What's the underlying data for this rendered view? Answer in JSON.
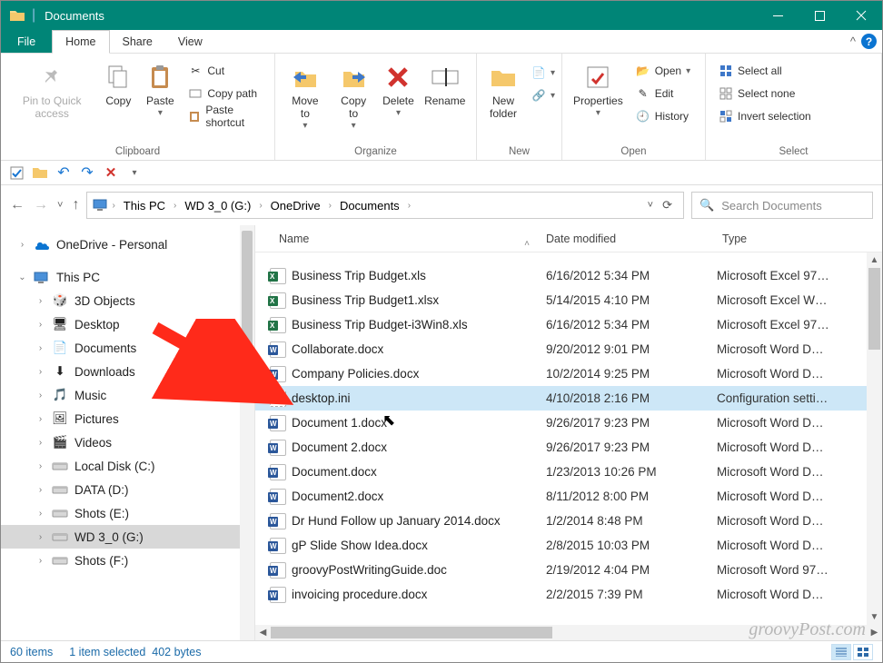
{
  "titlebar": {
    "title": "Documents"
  },
  "menubar": {
    "file": "File",
    "tabs": [
      "Home",
      "Share",
      "View"
    ],
    "active_index": 0
  },
  "ribbon": {
    "clipboard": {
      "label": "Clipboard",
      "pin": "Pin to Quick access",
      "copy": "Copy",
      "paste": "Paste",
      "cut": "Cut",
      "copy_path": "Copy path",
      "paste_shortcut": "Paste shortcut"
    },
    "organize": {
      "label": "Organize",
      "move_to": "Move to",
      "copy_to": "Copy to",
      "delete": "Delete",
      "rename": "Rename"
    },
    "new": {
      "label": "New",
      "new_folder": "New folder"
    },
    "open": {
      "label": "Open",
      "properties": "Properties",
      "open": "Open",
      "edit": "Edit",
      "history": "History"
    },
    "select": {
      "label": "Select",
      "select_all": "Select all",
      "select_none": "Select none",
      "invert": "Invert selection"
    }
  },
  "breadcrumb": [
    "This PC",
    "WD 3_0 (G:)",
    "OneDrive",
    "Documents"
  ],
  "search": {
    "placeholder": "Search Documents"
  },
  "tree": {
    "onedrive": "OneDrive - Personal",
    "thispc": "This PC",
    "items": [
      {
        "label": "3D Objects"
      },
      {
        "label": "Desktop"
      },
      {
        "label": "Documents"
      },
      {
        "label": "Downloads"
      },
      {
        "label": "Music"
      },
      {
        "label": "Pictures"
      },
      {
        "label": "Videos"
      },
      {
        "label": "Local Disk (C:)"
      },
      {
        "label": "DATA (D:)"
      },
      {
        "label": "Shots (E:)"
      },
      {
        "label": "WD 3_0 (G:)",
        "selected": true
      },
      {
        "label": "Shots (F:)"
      }
    ]
  },
  "columns": {
    "name": "Name",
    "date": "Date modified",
    "type": "Type"
  },
  "files": [
    {
      "icon": "excel",
      "name": "Business Trip Budget.xls",
      "date": "6/16/2012 5:34 PM",
      "type": "Microsoft Excel 97…"
    },
    {
      "icon": "excel",
      "name": "Business Trip Budget1.xlsx",
      "date": "5/14/2015 4:10 PM",
      "type": "Microsoft Excel W…"
    },
    {
      "icon": "excel",
      "name": "Business Trip Budget-i3Win8.xls",
      "date": "6/16/2012 5:34 PM",
      "type": "Microsoft Excel 97…"
    },
    {
      "icon": "word",
      "name": "Collaborate.docx",
      "date": "9/20/2012 9:01 PM",
      "type": "Microsoft Word D…"
    },
    {
      "icon": "word",
      "name": "Company Policies.docx",
      "date": "10/2/2014 9:25 PM",
      "type": "Microsoft Word D…"
    },
    {
      "icon": "ini",
      "name": "desktop.ini",
      "date": "4/10/2018 2:16 PM",
      "type": "Configuration setti…",
      "selected": true
    },
    {
      "icon": "word",
      "name": "Document 1.docx",
      "date": "9/26/2017 9:23 PM",
      "type": "Microsoft Word D…"
    },
    {
      "icon": "word",
      "name": "Document 2.docx",
      "date": "9/26/2017 9:23 PM",
      "type": "Microsoft Word D…"
    },
    {
      "icon": "word",
      "name": "Document.docx",
      "date": "1/23/2013 10:26 PM",
      "type": "Microsoft Word D…"
    },
    {
      "icon": "word",
      "name": "Document2.docx",
      "date": "8/11/2012 8:00 PM",
      "type": "Microsoft Word D…"
    },
    {
      "icon": "word",
      "name": "Dr Hund Follow up January 2014.docx",
      "date": "1/2/2014 8:48 PM",
      "type": "Microsoft Word D…"
    },
    {
      "icon": "word",
      "name": "gP Slide Show Idea.docx",
      "date": "2/8/2015 10:03 PM",
      "type": "Microsoft Word D…"
    },
    {
      "icon": "word",
      "name": "groovyPostWritingGuide.doc",
      "date": "2/19/2012 4:04 PM",
      "type": "Microsoft Word 97…"
    },
    {
      "icon": "word",
      "name": "invoicing procedure.docx",
      "date": "2/2/2015 7:39 PM",
      "type": "Microsoft Word D…"
    }
  ],
  "status": {
    "count": "60 items",
    "selection": "1 item selected",
    "size": "402 bytes"
  },
  "watermark": "groovyPost.com"
}
